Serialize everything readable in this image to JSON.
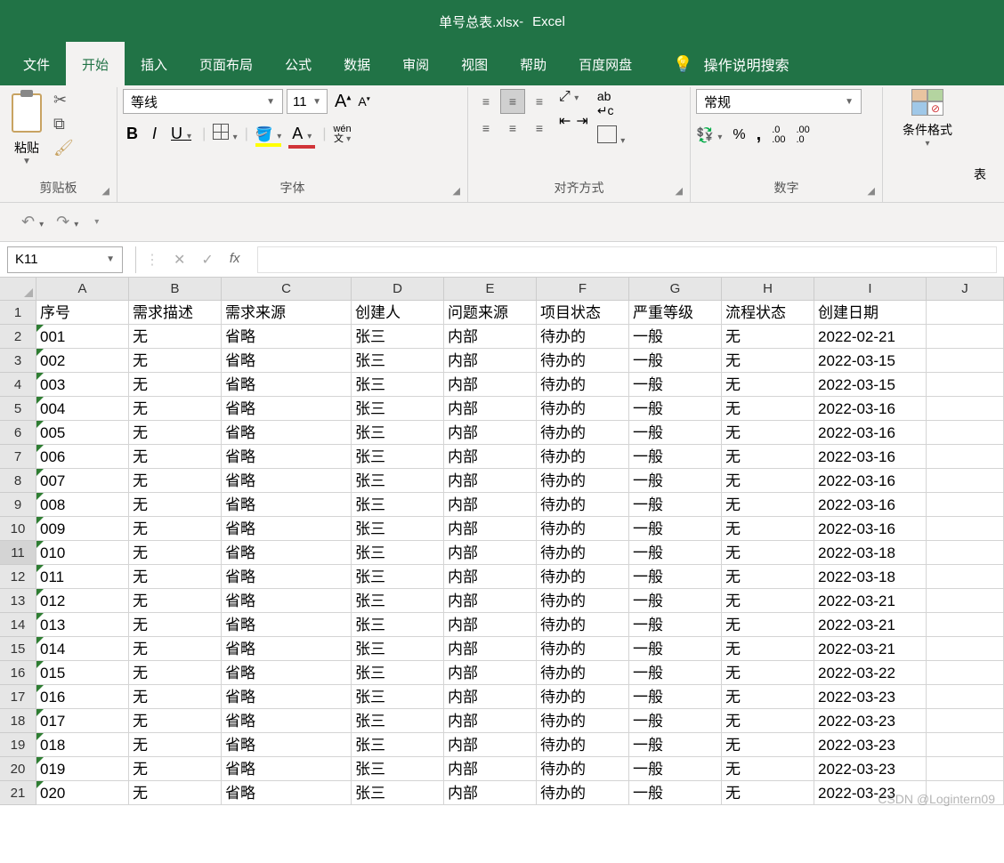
{
  "title": {
    "file": "单号总表.xlsx",
    "sep": " - ",
    "app": "Excel"
  },
  "menu": {
    "file": "文件",
    "home": "开始",
    "insert": "插入",
    "layout": "页面布局",
    "formula": "公式",
    "data": "数据",
    "review": "审阅",
    "view": "视图",
    "help": "帮助",
    "baidu": "百度网盘",
    "tellme": "操作说明搜索"
  },
  "ribbon": {
    "clipboard": {
      "paste": "粘贴",
      "group": "剪贴板"
    },
    "font": {
      "name": "等线",
      "size": "11",
      "bold": "B",
      "italic": "I",
      "underline": "U",
      "pinyin_top": "wén",
      "pinyin_bot": "文",
      "group": "字体"
    },
    "align": {
      "group": "对齐方式"
    },
    "number": {
      "format": "常规",
      "pct": "%",
      "comma": ",",
      "inc": ".0\n.00",
      "dec": ".00\n.0",
      "group": "数字"
    },
    "cf": {
      "label": "条件格式"
    },
    "tbl": {
      "label": "表"
    }
  },
  "name_box": "K11",
  "fx_label": "fx",
  "columns": [
    "A",
    "B",
    "C",
    "D",
    "E",
    "F",
    "G",
    "H",
    "I",
    "J"
  ],
  "headers": [
    "序号",
    "需求描述",
    "需求来源",
    "创建人",
    "问题来源",
    "项目状态",
    "严重等级",
    "流程状态",
    "创建日期"
  ],
  "rows": [
    [
      "001",
      "无",
      "省略",
      "张三",
      "内部",
      "待办的",
      "一般",
      "无",
      "2022-02-21"
    ],
    [
      "002",
      "无",
      "省略",
      "张三",
      "内部",
      "待办的",
      "一般",
      "无",
      "2022-03-15"
    ],
    [
      "003",
      "无",
      "省略",
      "张三",
      "内部",
      "待办的",
      "一般",
      "无",
      "2022-03-15"
    ],
    [
      "004",
      "无",
      "省略",
      "张三",
      "内部",
      "待办的",
      "一般",
      "无",
      "2022-03-16"
    ],
    [
      "005",
      "无",
      "省略",
      "张三",
      "内部",
      "待办的",
      "一般",
      "无",
      "2022-03-16"
    ],
    [
      "006",
      "无",
      "省略",
      "张三",
      "内部",
      "待办的",
      "一般",
      "无",
      "2022-03-16"
    ],
    [
      "007",
      "无",
      "省略",
      "张三",
      "内部",
      "待办的",
      "一般",
      "无",
      "2022-03-16"
    ],
    [
      "008",
      "无",
      "省略",
      "张三",
      "内部",
      "待办的",
      "一般",
      "无",
      "2022-03-16"
    ],
    [
      "009",
      "无",
      "省略",
      "张三",
      "内部",
      "待办的",
      "一般",
      "无",
      "2022-03-16"
    ],
    [
      "010",
      "无",
      "省略",
      "张三",
      "内部",
      "待办的",
      "一般",
      "无",
      "2022-03-18"
    ],
    [
      "011",
      "无",
      "省略",
      "张三",
      "内部",
      "待办的",
      "一般",
      "无",
      "2022-03-18"
    ],
    [
      "012",
      "无",
      "省略",
      "张三",
      "内部",
      "待办的",
      "一般",
      "无",
      "2022-03-21"
    ],
    [
      "013",
      "无",
      "省略",
      "张三",
      "内部",
      "待办的",
      "一般",
      "无",
      "2022-03-21"
    ],
    [
      "014",
      "无",
      "省略",
      "张三",
      "内部",
      "待办的",
      "一般",
      "无",
      "2022-03-21"
    ],
    [
      "015",
      "无",
      "省略",
      "张三",
      "内部",
      "待办的",
      "一般",
      "无",
      "2022-03-22"
    ],
    [
      "016",
      "无",
      "省略",
      "张三",
      "内部",
      "待办的",
      "一般",
      "无",
      "2022-03-23"
    ],
    [
      "017",
      "无",
      "省略",
      "张三",
      "内部",
      "待办的",
      "一般",
      "无",
      "2022-03-23"
    ],
    [
      "018",
      "无",
      "省略",
      "张三",
      "内部",
      "待办的",
      "一般",
      "无",
      "2022-03-23"
    ],
    [
      "019",
      "无",
      "省略",
      "张三",
      "内部",
      "待办的",
      "一般",
      "无",
      "2022-03-23"
    ],
    [
      "020",
      "无",
      "省略",
      "张三",
      "内部",
      "待办的",
      "一般",
      "无",
      "2022-03-23"
    ]
  ],
  "selected_row": 11,
  "watermark": "CSDN @Logintern09"
}
